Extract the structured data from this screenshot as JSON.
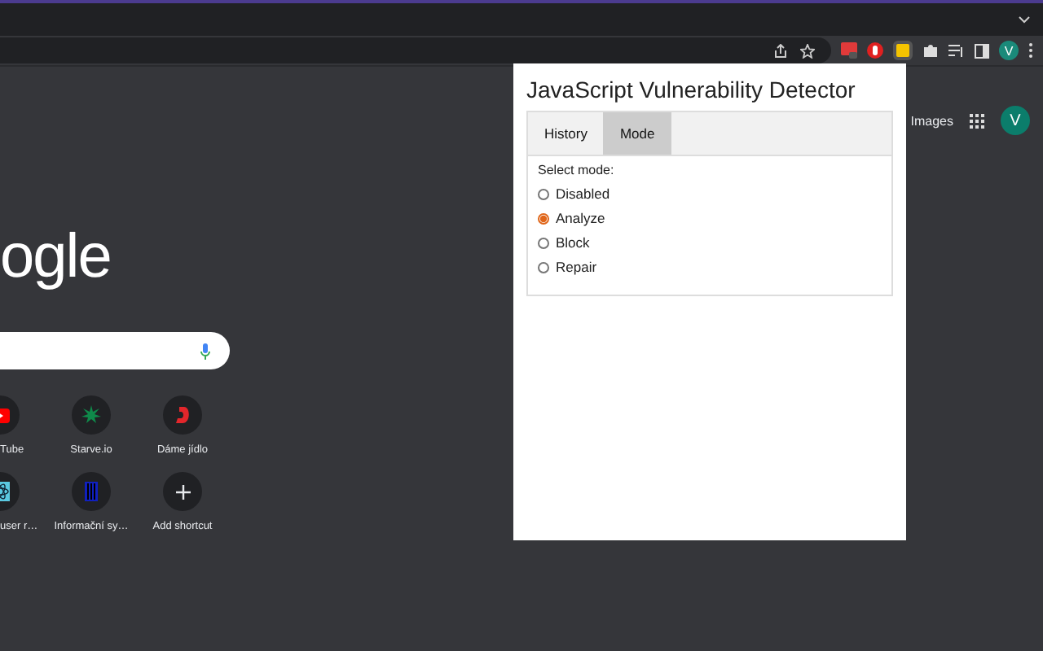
{
  "toolbar": {
    "profile_initial": "V"
  },
  "new_tab": {
    "logo_text": "ogle",
    "images_link": "Images",
    "account_initial": "V",
    "shortcuts": [
      {
        "label": "Tube",
        "kind": "video"
      },
      {
        "label": "Starve.io",
        "kind": "splat"
      },
      {
        "label": "Dáme jídlo",
        "kind": "letter"
      },
      {
        "label": "user r…",
        "kind": "atom"
      },
      {
        "label": "Informační sy…",
        "kind": "bars"
      },
      {
        "label": "Add shortcut",
        "kind": "add"
      }
    ]
  },
  "popup": {
    "title": "JavaScript Vulnerability Detector",
    "tabs": [
      {
        "label": "History",
        "selected": false
      },
      {
        "label": "Mode",
        "selected": true
      }
    ],
    "prompt": "Select mode:",
    "modes": [
      {
        "label": "Disabled",
        "selected": false
      },
      {
        "label": "Analyze",
        "selected": true
      },
      {
        "label": "Block",
        "selected": false
      },
      {
        "label": "Repair",
        "selected": false
      }
    ]
  }
}
